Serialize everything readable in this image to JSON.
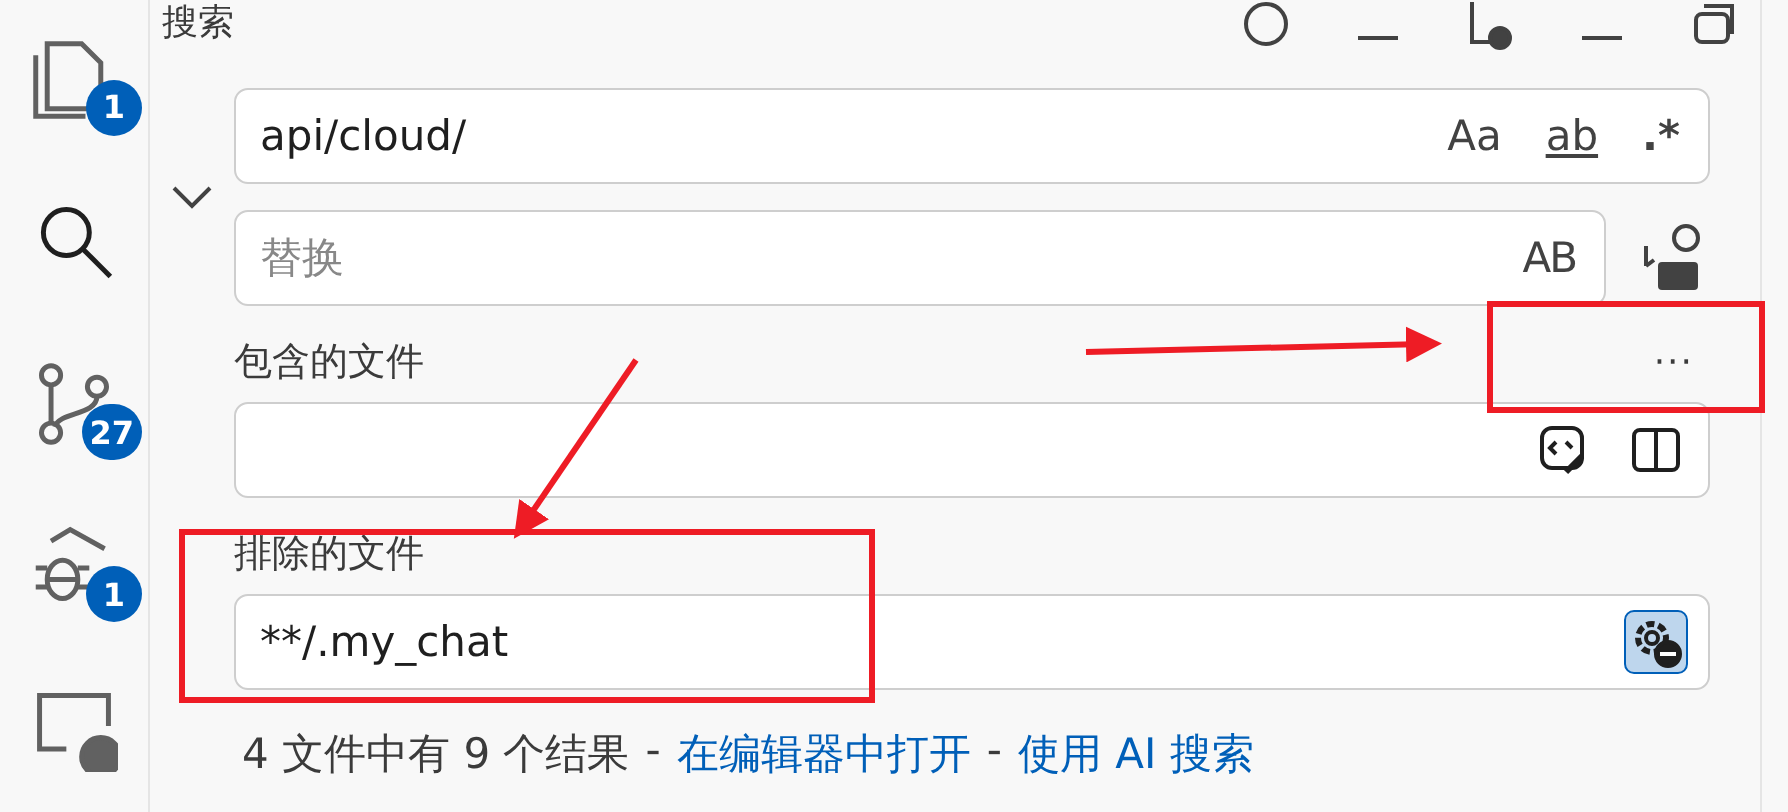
{
  "activity_bar": [
    {
      "kind": "files",
      "badge": "1",
      "selected": false
    },
    {
      "kind": "search",
      "selected": true
    },
    {
      "kind": "source-control",
      "badge": "27",
      "selected": false
    },
    {
      "kind": "debug",
      "badge": "1",
      "selected": false
    },
    {
      "kind": "remote",
      "selected": false
    }
  ],
  "panel": {
    "title": "搜索",
    "search": {
      "value": "api/cloud/",
      "toggles": [
        {
          "label": "Aa",
          "kind": "case",
          "selected": false
        },
        {
          "label": "ab",
          "kind": "word",
          "selected": false
        },
        {
          "label": ".*",
          "kind": "regex",
          "selected": false
        }
      ]
    },
    "replace": {
      "placeholder": "替换",
      "toggles": [
        {
          "label": "AB",
          "kind": "preserve-case",
          "selected": false
        }
      ]
    },
    "more_label": "···",
    "include": {
      "label": "包含的文件",
      "only_open_editors": false
    },
    "exclude": {
      "label": "排除的文件",
      "value": "**/.my_chat",
      "use_exclude_settings": true
    },
    "results": [
      {
        "kind": "text",
        "text": "4 文件中有 9 个结果"
      },
      {
        "kind": "text",
        "text": "-"
      },
      {
        "kind": "link",
        "text": "在编辑器中打开"
      },
      {
        "kind": "text",
        "text": "-"
      },
      {
        "kind": "link",
        "text": "使用 AI 搜索"
      }
    ]
  }
}
